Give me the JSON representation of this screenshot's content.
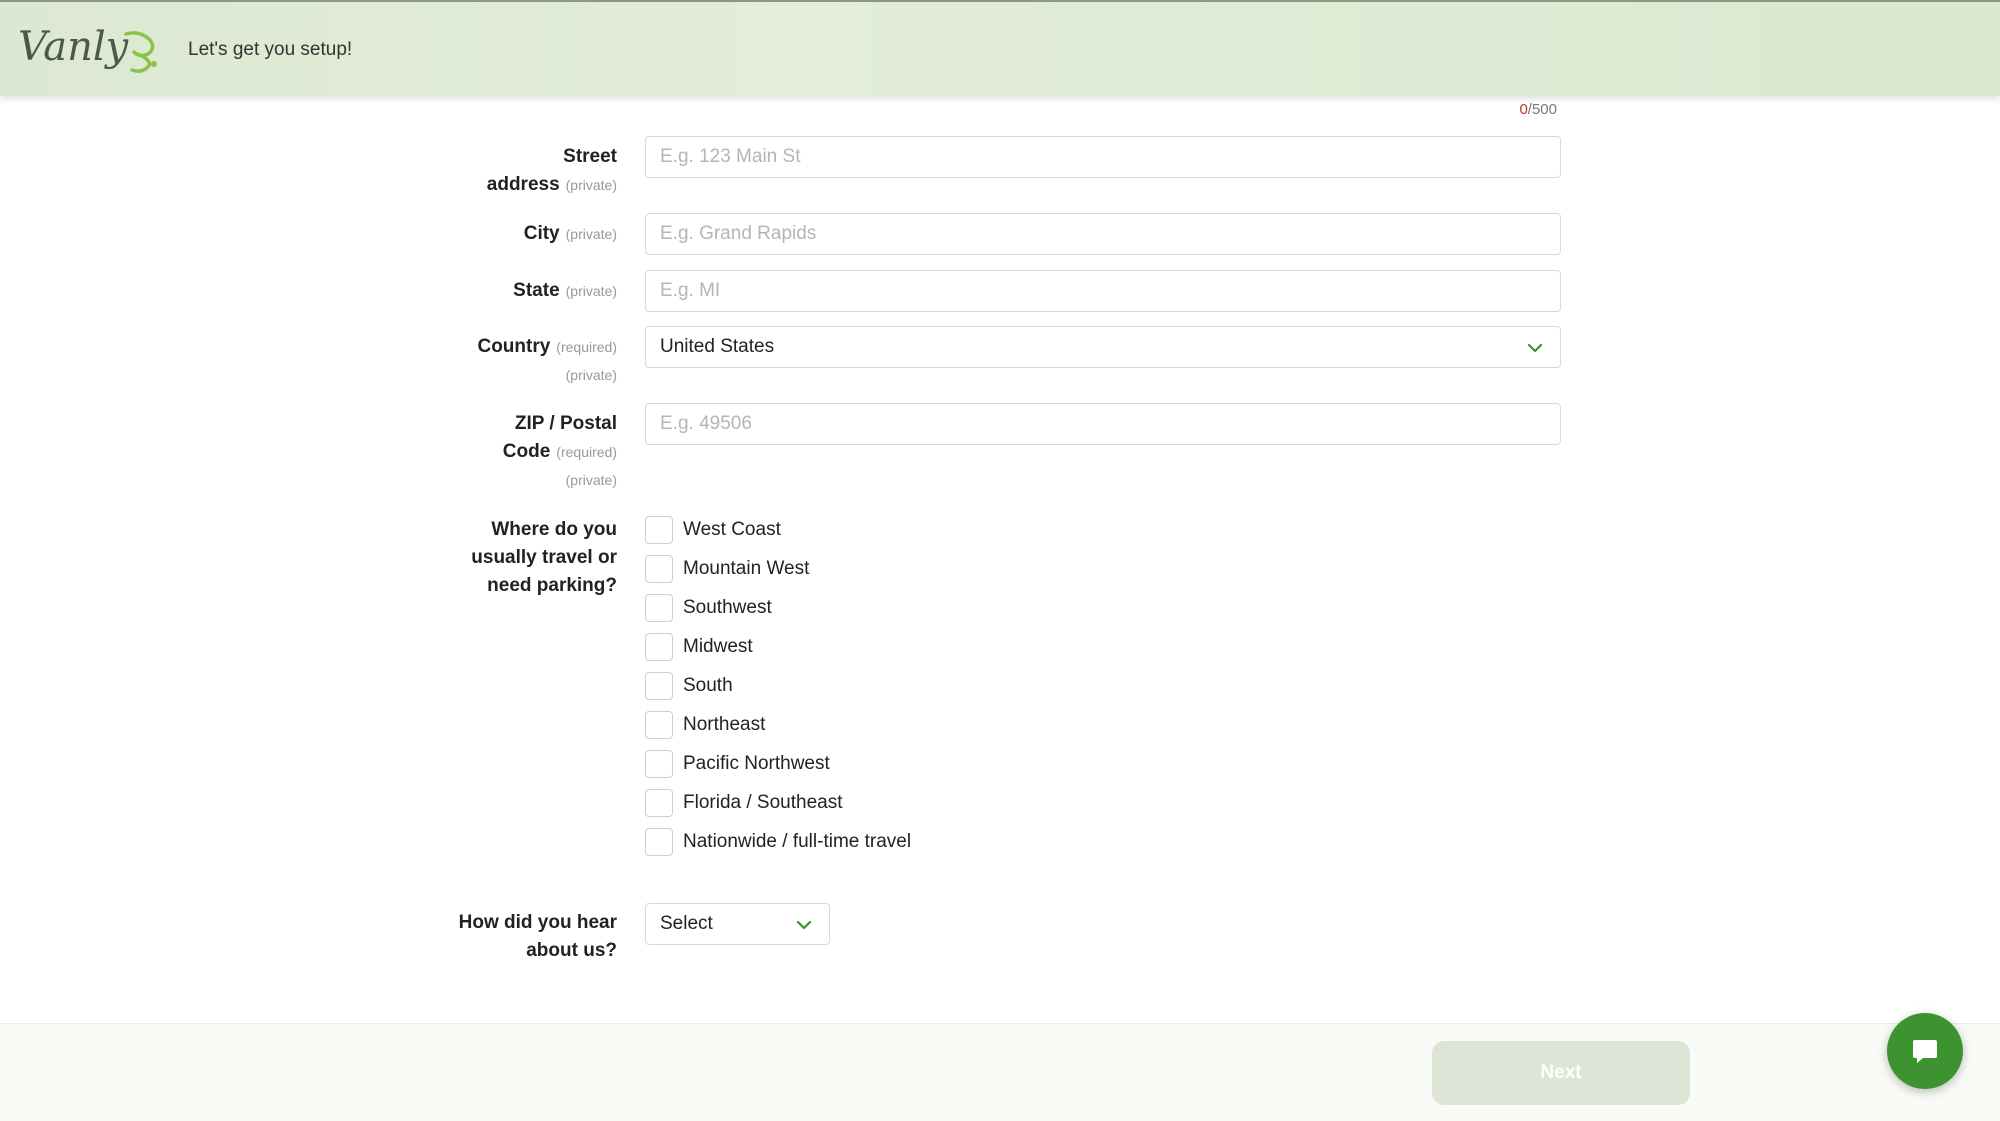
{
  "header": {
    "logo_text": "Vanly",
    "subtitle": "Let's get you setup!"
  },
  "counter": {
    "count": "0",
    "max": "/500"
  },
  "fields": {
    "street": {
      "label_line1": "Street",
      "label_line2": "address",
      "tag": "(private)",
      "placeholder": "E.g. 123 Main St"
    },
    "city": {
      "label": "City",
      "tag": "(private)",
      "placeholder": "E.g. Grand Rapids"
    },
    "state": {
      "label": "State",
      "tag": "(private)",
      "placeholder": "E.g. MI"
    },
    "country": {
      "label": "Country",
      "tag_required": "(required)",
      "tag_private": "(private)",
      "value": "United States"
    },
    "zip": {
      "label_line1": "ZIP / Postal",
      "label_line2": "Code",
      "tag_required": "(required)",
      "tag_private": "(private)",
      "placeholder": "E.g. 49506"
    }
  },
  "travel": {
    "label_line1": "Where do you",
    "label_line2": "usually travel or",
    "label_line3": "need parking?",
    "options": [
      "West Coast",
      "Mountain West",
      "Southwest",
      "Midwest",
      "South",
      "Northeast",
      "Pacific Northwest",
      "Florida / Southeast",
      "Nationwide / full-time travel"
    ]
  },
  "hear": {
    "label_line1": "How did you hear",
    "label_line2": "about us?",
    "value": "Select"
  },
  "footer": {
    "next_label": "Next"
  },
  "colors": {
    "accent": "#3d9330",
    "counter_count": "#b23a2e",
    "next_disabled": "#dde5d6"
  },
  "icons": {
    "chevron": "chevron-down-icon",
    "chat": "chat-icon"
  }
}
